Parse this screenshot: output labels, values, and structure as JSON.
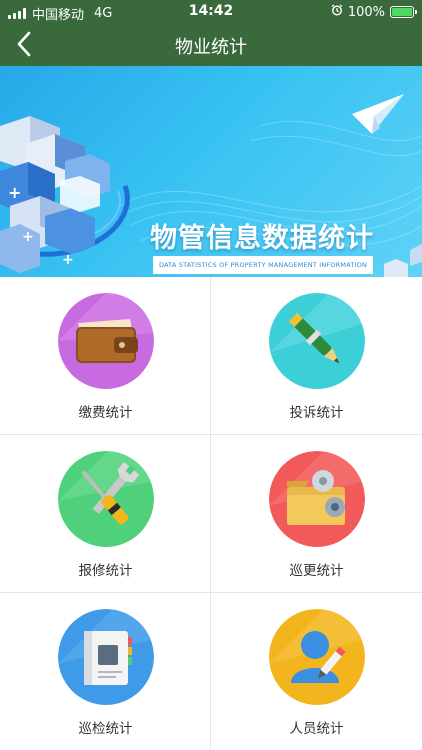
{
  "status_bar": {
    "carrier": "中国移动",
    "network": "4G",
    "time": "14:42",
    "battery": "100%"
  },
  "nav": {
    "title": "物业统计"
  },
  "banner": {
    "title": "物管信息数据统计",
    "subtitle": "DATA STATISTICS OF PROPERTY MANAGEMENT INFORMATION"
  },
  "menu": [
    {
      "label": "缴费统计",
      "icon": "wallet-icon",
      "color": "#c86be0"
    },
    {
      "label": "投诉统计",
      "icon": "pen-icon",
      "color": "#3ccfd8"
    },
    {
      "label": "报修统计",
      "icon": "tools-icon",
      "color": "#4fd07a"
    },
    {
      "label": "巡更统计",
      "icon": "folder-gears-icon",
      "color": "#f25a5a"
    },
    {
      "label": "巡检统计",
      "icon": "notebook-icon",
      "color": "#3f9be8"
    },
    {
      "label": "人员统计",
      "icon": "user-icon",
      "color": "#f2b51e"
    }
  ]
}
